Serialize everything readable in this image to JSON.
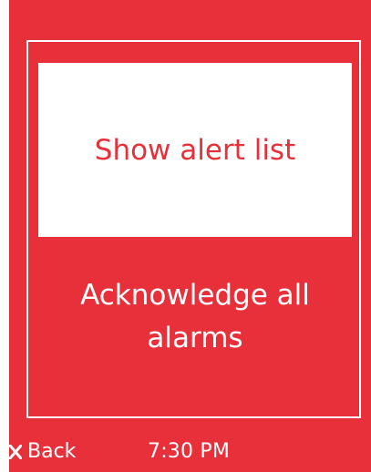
{
  "menu": {
    "items": [
      {
        "label": "Show alert list",
        "selected": true
      },
      {
        "label": "Acknowledge all alarms",
        "selected": false
      }
    ]
  },
  "footer": {
    "back_label": "Back",
    "back_icon": "x-icon",
    "time": "7:30 PM"
  },
  "colors": {
    "accent_red": "#e8303a",
    "white": "#ffffff"
  }
}
